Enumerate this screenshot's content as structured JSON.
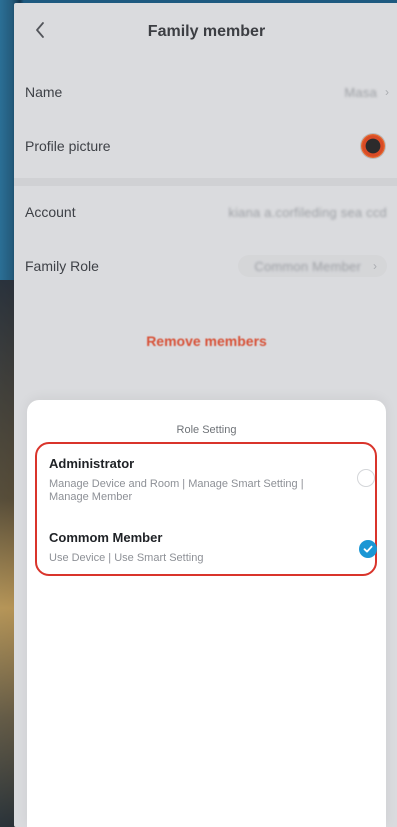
{
  "header": {
    "title": "Family member"
  },
  "profile": {
    "name_label": "Name",
    "name_value": "Masa",
    "picture_label": "Profile picture",
    "account_label": "Account",
    "account_value": "kiana a.corfileding sea ccd",
    "family_role_label": "Family Role",
    "family_role_value": "Common Member"
  },
  "actions": {
    "remove_label": "Remove members"
  },
  "role_sheet": {
    "title": "Role Setting",
    "options": [
      {
        "title": "Administrator",
        "description": "Manage Device and Room | Manage Smart Setting | Manage Member",
        "selected": false
      },
      {
        "title": "Commom Member",
        "description": "Use Device | Use Smart Setting",
        "selected": true
      }
    ]
  },
  "colors": {
    "accent": "#1a96d4",
    "danger": "#e45336",
    "highlight": "#d9342b"
  },
  "icons": {
    "back": "chevron-left-icon",
    "row_arrow": "chevron-right-icon",
    "selected": "checkmark-circle-icon"
  }
}
